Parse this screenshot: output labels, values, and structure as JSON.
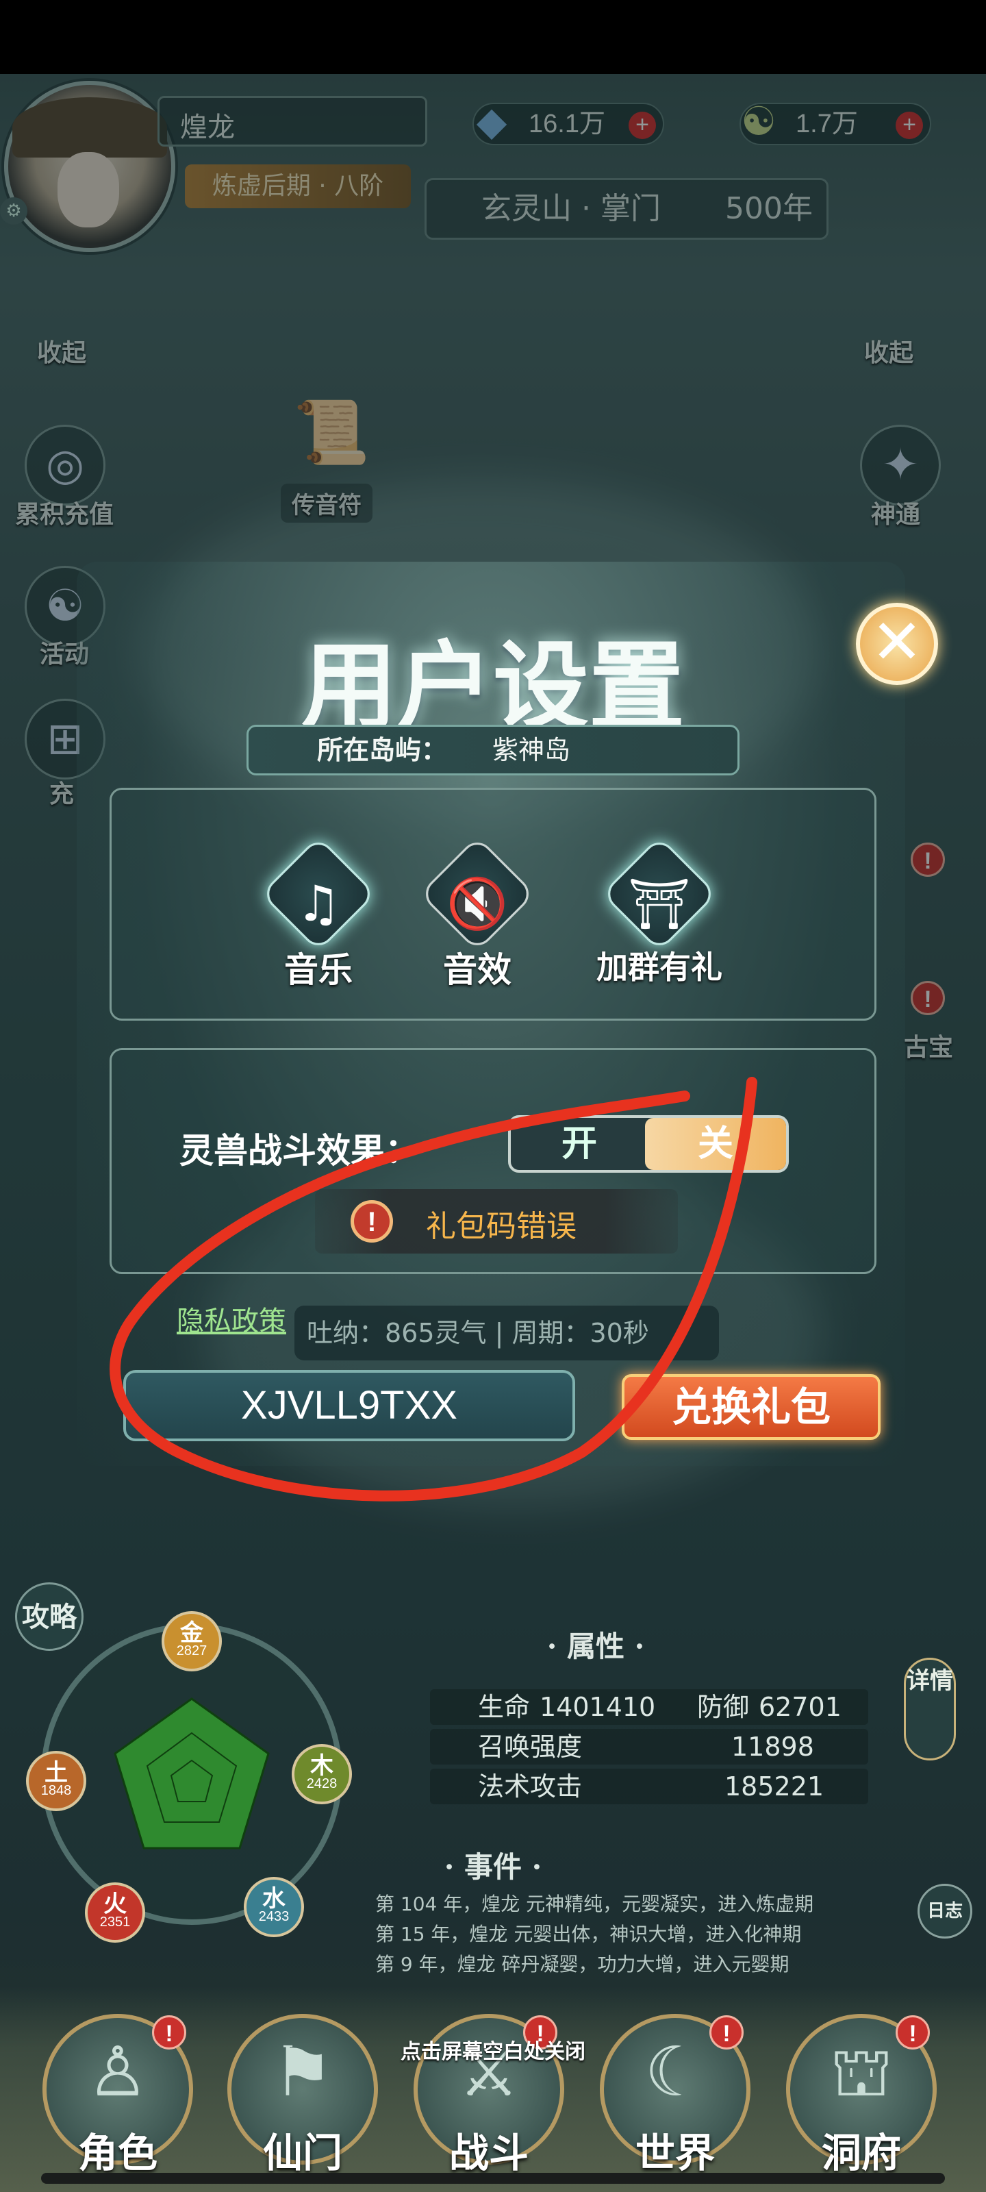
{
  "header": {
    "player_name": "煌龙",
    "realm": "炼虚后期 · 八阶",
    "spirit_stones": "16.1万",
    "jade": "1.7万",
    "location": "玄灵山 · 掌门",
    "years": "500年",
    "plus_symbol": "+"
  },
  "left_sidebar": {
    "collapse": "收起",
    "items": [
      "累积充值",
      "活动",
      "充"
    ]
  },
  "right_sidebar": {
    "collapse": "收起",
    "items": [
      "神通",
      "古宝"
    ]
  },
  "center_link": "传音符",
  "modal": {
    "title": "用户设置",
    "island_label": "所在岛屿：",
    "island_value": "紫神岛",
    "close_symbol": "✕",
    "options": [
      {
        "label": "音乐",
        "icon": "music-note-icon"
      },
      {
        "label": "音效",
        "icon": "sound-muted-icon"
      },
      {
        "label": "加群有礼",
        "icon": "pavilion-icon"
      }
    ],
    "beast_effect_label": "灵兽战斗效果：",
    "toggle_on": "开",
    "toggle_off": "关",
    "error_toast": "礼包码错误",
    "privacy_link": "隐私政策",
    "tuna_text": "吐纳：865灵气 | 周期：30秒",
    "code_value": "XJVLL9TXX",
    "redeem_button": "兑换礼包"
  },
  "dashboard": {
    "guide": "攻略",
    "elements": [
      {
        "name": "金",
        "value": "2827",
        "color": "#c9902f"
      },
      {
        "name": "木",
        "value": "2428",
        "color": "#6f8a2c"
      },
      {
        "name": "水",
        "value": "2433",
        "color": "#3a7f90"
      },
      {
        "name": "火",
        "value": "2351",
        "color": "#c2362a"
      },
      {
        "name": "土",
        "value": "1848",
        "color": "#b8672a"
      }
    ],
    "attributes_title": "· 属性 ·",
    "attributes": {
      "hp_label": "生命",
      "hp_value": "1401410",
      "def_label": "防御",
      "def_value": "62701",
      "summon_label": "召唤强度",
      "summon_value": "11898",
      "spell_label": "法术攻击",
      "spell_value": "185221"
    },
    "detail_button": "详情",
    "events_title": "· 事件 ·",
    "events": [
      "第 104 年，煌龙 元神精纯，元婴凝实，进入炼虚期",
      "第 15 年，煌龙 元婴出体，神识大增，进入化神期",
      "第 9 年，煌龙 碎丹凝婴，功力大增，进入元婴期"
    ],
    "log_button": "日志"
  },
  "close_hint": "点击屏幕空白处关闭",
  "navbar": [
    {
      "label": "角色",
      "icon": "character-icon"
    },
    {
      "label": "仙门",
      "icon": "sect-icon"
    },
    {
      "label": "战斗",
      "icon": "battle-icon"
    },
    {
      "label": "世界",
      "icon": "world-icon"
    },
    {
      "label": "洞府",
      "icon": "cave-icon"
    }
  ],
  "colors": {
    "accent_gold": "#f0b460",
    "error_text": "#f7b64c",
    "privacy_green": "#9fe48f",
    "annotation_red": "#e8321f"
  }
}
